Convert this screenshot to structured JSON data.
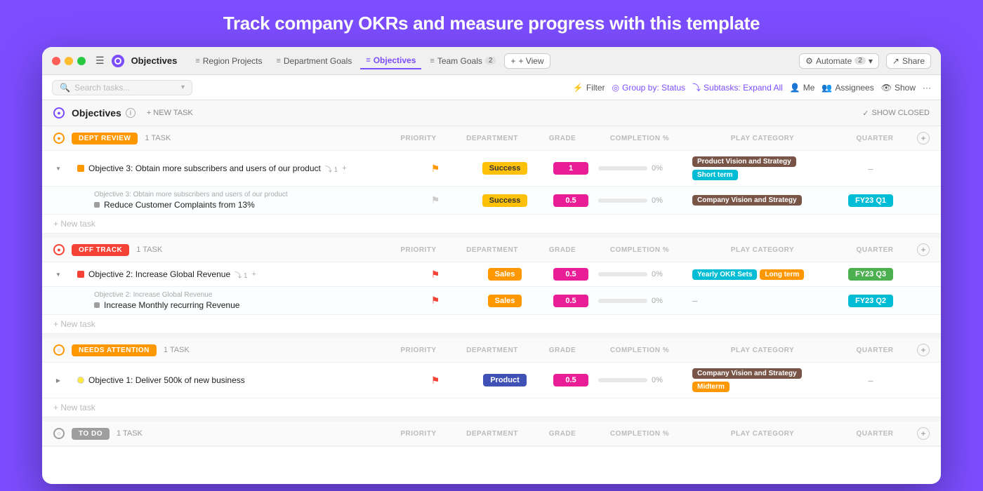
{
  "page": {
    "title": "Track company OKRs and measure progress with this template"
  },
  "titlebar": {
    "app_name": "Objectives",
    "tabs": [
      {
        "label": "Region Projects",
        "icon": "≡",
        "active": false
      },
      {
        "label": "Department Goals",
        "icon": "≡",
        "active": false
      },
      {
        "label": "Objectives",
        "icon": "≡",
        "active": true
      },
      {
        "label": "Team Goals",
        "icon": "≡",
        "active": false,
        "badge": "2"
      }
    ],
    "view_btn": "+ View",
    "automate_btn": "Automate",
    "automate_count": "2",
    "share_btn": "Share"
  },
  "toolbar": {
    "search_placeholder": "Search tasks...",
    "filter_btn": "Filter",
    "group_btn": "Group by: Status",
    "subtasks_btn": "Subtasks: Expand All",
    "me_btn": "Me",
    "assignees_btn": "Assignees",
    "show_btn": "Show"
  },
  "objectives_section": {
    "title": "Objectives",
    "new_task_label": "+ NEW TASK",
    "show_closed_label": "SHOW CLOSED"
  },
  "col_headers": {
    "priority": "PRIORITY",
    "department": "DEPARTMENT",
    "grade": "GRADE",
    "completion": "COMPLETION %",
    "play_category": "PLAY CATEGORY",
    "quarter": "QUARTER"
  },
  "groups": [
    {
      "id": "dept-review",
      "badge_label": "DEPT REVIEW",
      "badge_class": "badge-dept",
      "task_count": "1 TASK",
      "tasks": [
        {
          "id": "obj3",
          "name": "Objective 3: Obtain more subscribers and users of our product",
          "sub_label": "",
          "is_parent": true,
          "meta": "1",
          "priority_flag": "orange",
          "department": "Success",
          "dept_class": "dept-success",
          "grade": "1",
          "grade_class": "grade-pink",
          "completion_pct": "0%",
          "completion_fill": 0,
          "play_tags": [
            {
              "label": "Product Vision and Strategy",
              "class": "tag-brown"
            },
            {
              "label": "Short term",
              "class": "tag-teal"
            }
          ],
          "quarter": null,
          "quarter_dash": "–"
        },
        {
          "id": "obj3-sub",
          "name": "Reduce Customer Complaints from 13%",
          "sub_label": "Objective 3: Obtain more subscribers and users of our product",
          "is_parent": false,
          "priority_flag": "grey",
          "department": "Success",
          "dept_class": "dept-success",
          "grade": "0.5",
          "grade_class": "grade-pink",
          "completion_pct": "0%",
          "completion_fill": 0,
          "play_tags": [
            {
              "label": "Company Vision and Strategy",
              "class": "tag-brown"
            }
          ],
          "quarter": "FY23 Q1",
          "quarter_class": "quarter-q1"
        }
      ]
    },
    {
      "id": "off-track",
      "badge_label": "OFF TRACK",
      "badge_class": "badge-off",
      "task_count": "1 TASK",
      "tasks": [
        {
          "id": "obj2",
          "name": "Objective 2: Increase Global Revenue",
          "sub_label": "",
          "is_parent": true,
          "meta": "1",
          "priority_flag": "red",
          "department": "Sales",
          "dept_class": "dept-sales",
          "grade": "0.5",
          "grade_class": "grade-pink",
          "completion_pct": "0%",
          "completion_fill": 0,
          "play_tags": [
            {
              "label": "Yearly OKR Sets",
              "class": "tag-teal"
            },
            {
              "label": "Long term",
              "class": "tag-orange"
            }
          ],
          "quarter": "FY23 Q3",
          "quarter_class": "quarter-q3"
        },
        {
          "id": "obj2-sub",
          "name": "Increase Monthly recurring Revenue",
          "sub_label": "Objective 2: Increase Global Revenue",
          "is_parent": false,
          "priority_flag": "red",
          "department": "Sales",
          "dept_class": "dept-sales",
          "grade": "0.5",
          "grade_class": "grade-pink",
          "completion_pct": "0%",
          "completion_fill": 0,
          "play_tags": [],
          "quarter": "FY23 Q2",
          "quarter_class": "quarter-q2",
          "quarter_dash": "–"
        }
      ]
    },
    {
      "id": "needs-attention",
      "badge_label": "NEEDS ATTENTION",
      "badge_class": "badge-needs",
      "task_count": "1 TASK",
      "tasks": [
        {
          "id": "obj1",
          "name": "Objective 1: Deliver 500k of new business",
          "sub_label": "",
          "is_parent": true,
          "meta": "",
          "priority_flag": "red",
          "department": "Product",
          "dept_class": "dept-product",
          "grade": "0.5",
          "grade_class": "grade-pink",
          "completion_pct": "0%",
          "completion_fill": 0,
          "play_tags": [
            {
              "label": "Company Vision and Strategy",
              "class": "tag-brown"
            },
            {
              "label": "Midterm",
              "class": "tag-orange"
            }
          ],
          "quarter": null,
          "quarter_dash": "–"
        }
      ]
    },
    {
      "id": "todo",
      "badge_label": "TO DO",
      "badge_class": "badge-todo",
      "task_count": "1 TASK",
      "tasks": []
    }
  ],
  "icons": {
    "search": "🔍",
    "filter": "⚡",
    "group": "◎",
    "subtask": "⤵",
    "person": "👤",
    "eye": "👁",
    "check": "✓",
    "plus": "+",
    "info": "i",
    "dots": "···",
    "expand": "▶",
    "collapse": "▼"
  }
}
